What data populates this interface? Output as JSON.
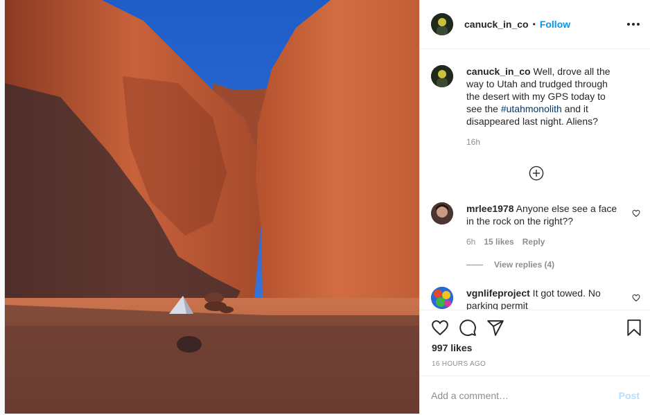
{
  "post": {
    "image_alt": "Red rock canyon with a small triangular metal object on the sand",
    "author": {
      "username": "canuck_in_co",
      "avatar_icon": "avatar-icon"
    },
    "header": {
      "separator": "•",
      "follow_label": "Follow",
      "more_icon": "more-options-icon"
    },
    "caption": {
      "username": "canuck_in_co",
      "text_before": " Well, drove all the way to Utah and trudged through the desert with my GPS today to see the ",
      "hashtag": "#utahmonolith",
      "text_after": " and it disappeared last night. Aliens?",
      "time": "16h"
    },
    "load_more_icon": "plus-circle-icon",
    "comments": [
      {
        "username": "mrlee1978",
        "text": " Anyone else see a face in the rock on the right??",
        "time": "6h",
        "likes": "15 likes",
        "reply_label": "Reply",
        "view_replies": "View replies (4)"
      },
      {
        "username": "vgnlifeproject",
        "text": " It got towed. No parking permit"
      }
    ],
    "actions": {
      "like_icon": "heart-icon",
      "comment_icon": "comment-icon",
      "share_icon": "paper-plane-icon",
      "save_icon": "bookmark-icon"
    },
    "likes": "997 likes",
    "timestamp": "16 HOURS AGO",
    "add_comment": {
      "placeholder": "Add a comment…",
      "post_label": "Post"
    }
  },
  "colors": {
    "accent": "#0095f6",
    "post_disabled": "#b2dffc",
    "hashtag": "#00376b",
    "muted": "#8e8e8e"
  }
}
